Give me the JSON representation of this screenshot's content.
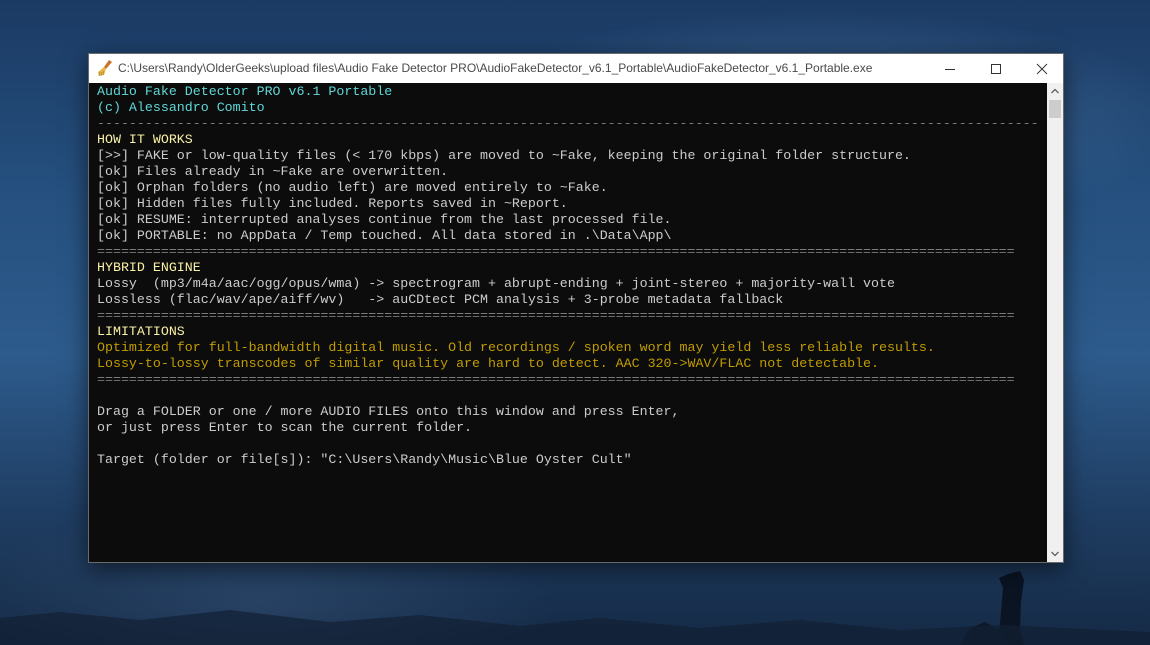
{
  "window": {
    "title": "C:\\Users\\Randy\\OlderGeeks\\upload files\\Audio Fake Detector PRO\\AudioFakeDetector_v6.1_Portable\\AudioFakeDetector_v6.1_Portable.exe",
    "icon": "broom-icon",
    "controls": {
      "minimize": "minimize-icon",
      "maximize": "maximize-icon",
      "close": "close-icon"
    }
  },
  "console": {
    "lines": [
      "Audio Fake Detector PRO v6.1 Portable",
      "(c) Alessandro Comito",
      "----------------------------------------------------------------------------------------------------------------------",
      "HOW IT WORKS",
      "[>>] FAKE or low-quality files (< 170 kbps) are moved to ~Fake, keeping the original folder structure.",
      "[ok] Files already in ~Fake are overwritten.",
      "[ok] Orphan folders (no audio left) are moved entirely to ~Fake.",
      "[ok] Hidden files fully included. Reports saved in ~Report.",
      "[ok] RESUME: interrupted analyses continue from the last processed file.",
      "[ok] PORTABLE: no AppData / Temp touched. All data stored in .\\Data\\App\\",
      "===================================================================================================================",
      "HYBRID ENGINE",
      "Lossy  (mp3/m4a/aac/ogg/opus/wma) -> spectrogram + abrupt-ending + joint-stereo + majority-wall vote",
      "Lossless (flac/wav/ape/aiff/wv)   -> auCDtect PCM analysis + 3-probe metadata fallback",
      "===================================================================================================================",
      "LIMITATIONS",
      "Optimized for full-bandwidth digital music. Old recordings / spoken word may yield less reliable results.",
      "Lossy-to-lossy transcodes of similar quality are hard to detect. AAC 320->WAV/FLAC not detectable.",
      "===================================================================================================================",
      "",
      "Drag a FOLDER or one / more AUDIO FILES onto this window and press Enter,",
      "or just press Enter to scan the current folder.",
      "",
      "Target (folder or file[s]): \"C:\\Users\\Randy\\Music\\Blue Oyster Cult\""
    ],
    "colors": {
      "cyan": "#61d6d6",
      "yellow": "#f9f1a5",
      "orange": "#c19c00",
      "white": "#cccccc",
      "background": "#0c0c0c"
    }
  }
}
